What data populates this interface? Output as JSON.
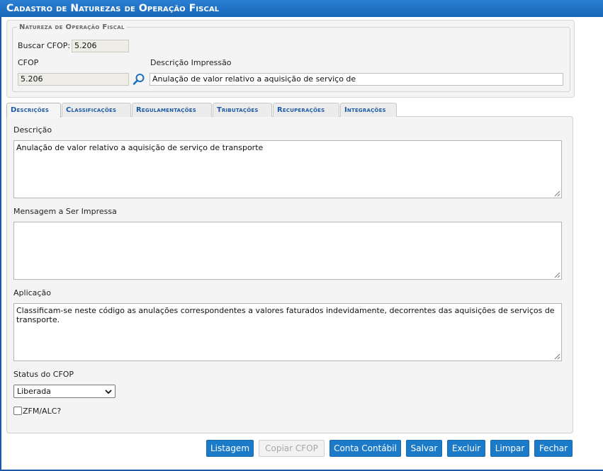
{
  "window": {
    "title": "Cadastro de Naturezas de Operação Fiscal"
  },
  "header_section": {
    "legend": "Natureza de Operação Fiscal",
    "search_cfop_label": "Buscar CFOP:",
    "search_cfop_value": "5.206",
    "cfop_label": "CFOP",
    "cfop_value": "5.206",
    "print_desc_label": "Descrição Impressão",
    "print_desc_value": "Anulação de valor relativo a aquisição de serviço de"
  },
  "tabs": [
    {
      "label": "Descrições",
      "active": true
    },
    {
      "label": "Classificações"
    },
    {
      "label": "Regulamentações"
    },
    {
      "label": "Tributações"
    },
    {
      "label": "Recuperações"
    },
    {
      "label": "Integrações"
    }
  ],
  "form": {
    "descricao_label": "Descrição",
    "descricao_value": "Anulação de valor relativo a aquisição de serviço de transporte",
    "mensagem_label": "Mensagem a Ser Impressa",
    "mensagem_value": "",
    "aplicacao_label": "Aplicação",
    "aplicacao_value": "Classificam-se neste código as anulações correspondentes a valores faturados indevidamente, decorrentes das aquisições de serviços de transporte.",
    "status_label": "Status do CFOP",
    "status_value": "Liberada",
    "zfm_label": "ZFM/ALC?",
    "zfm_checked": false
  },
  "buttons": {
    "listagem": "Listagem",
    "copiar": "Copiar CFOP",
    "conta": "Conta Contábil",
    "salvar": "Salvar",
    "excluir": "Excluir",
    "limpar": "Limpar",
    "fechar": "Fechar"
  },
  "colors": {
    "accent": "#1b7bc9",
    "titlebar": "#1a6fc4",
    "tab_text": "#1a5aa6"
  },
  "icons": {
    "search": "search-icon",
    "dropdown": "chevron-down-icon",
    "resize": "resize-grip-icon"
  }
}
